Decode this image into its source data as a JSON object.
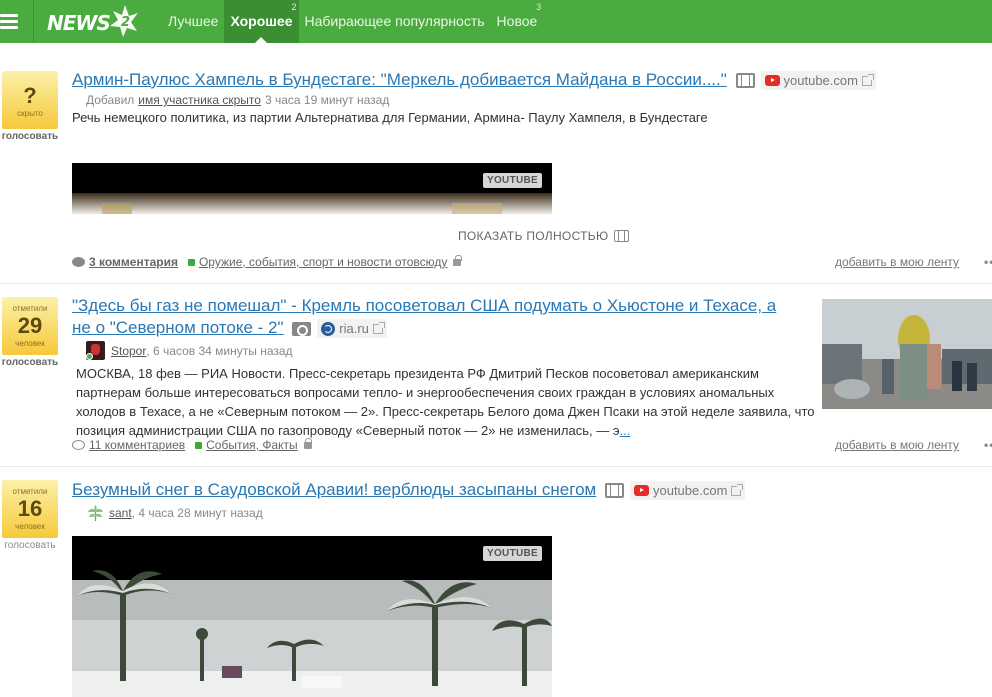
{
  "topbar": {
    "logo_text": "NEWS",
    "nav": [
      {
        "label": "Лучшее",
        "sup": ""
      },
      {
        "label": "Хорошее",
        "sup": "2"
      },
      {
        "label": "Набирающее популярность",
        "sup": ""
      },
      {
        "label": "Новое",
        "sup": "3"
      }
    ]
  },
  "posts": [
    {
      "vote": {
        "top": "",
        "num": "?",
        "bottom": "скрыто",
        "label": "голосовать"
      },
      "title": "Армин-Паулюс Хампель в Бундестаге: \"Меркель добивается Майдана в России....\"",
      "source": "youtube.com",
      "meta_prefix": "Добавил",
      "user": "имя участника скрыто",
      "time": "3 часа 19 минут назад",
      "desc": "Речь немецкого политика, из партии Альтернатива для Германии, Армина- Паулу Хампеля, в Бундестаге",
      "video_badge": "YOUTUBE",
      "show_full": "ПОКАЗАТЬ ПОЛНОСТЬЮ",
      "comments": "3 комментария",
      "tag": "Оружие, события, спорт и новости отовсюду",
      "add": "добавить в мою ленту",
      "dots": "•••"
    },
    {
      "vote": {
        "top": "отметили",
        "num": "29",
        "bottom": "человек",
        "label": "голосовать"
      },
      "title_line1": "\"Здесь бы газ не помешал\" - Кремль посоветовал США подумать о Хьюстоне и Техасе, а",
      "title_line2": "не о \"Северном потоке - 2\"",
      "source": "ria.ru",
      "user": "Stopor",
      "time": ", 6 часов 34 минуты назад",
      "desc": "МОСКВА, 18 фев — РИА Новости. Пресс-секретарь президента РФ Дмитрий Песков посоветовал американским партнерам больше интересоваться вопросами тепло- и энергообеспечения своих граждан в условиях аномальных холодов в Техасе, а не «Северным потоком — 2». Пресс-секретарь Белого дома Джен Псаки на этой неделе заявила, что позиция администрации США по газопроводу «Северный поток — 2» не изменилась, — э",
      "more": "...",
      "comments": "11 комментариев",
      "tag": "События, Факты",
      "add": "добавить в мою ленту",
      "dots": "•••"
    },
    {
      "vote": {
        "top": "отметили",
        "num": "16",
        "bottom": "человек",
        "label": "голосовать"
      },
      "title": "Безумный снег в Саудовской Аравии! верблюды засыпаны снегом",
      "source": "youtube.com",
      "user": "sant",
      "time": ", 4 часа 28 минут назад",
      "video_badge": "YOUTUBE"
    }
  ],
  "colors": {
    "brand_green": "#4aab3f",
    "link_blue": "#2a78b4",
    "vote_yellow": "#f6c93a"
  }
}
